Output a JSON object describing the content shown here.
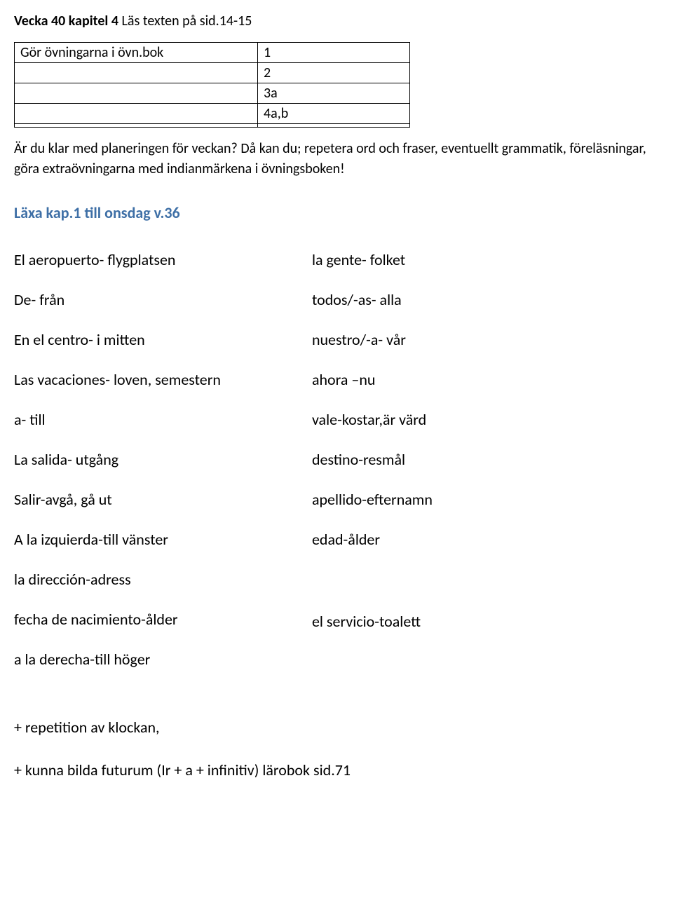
{
  "header": {
    "bold": "Vecka 40 kapitel 4",
    "rest": "  Läs texten på sid.14-15"
  },
  "exerciseTable": {
    "label": "Gör övningarna  i övn.bok",
    "rows": [
      "1",
      "2",
      "3a",
      "4a,b",
      ""
    ]
  },
  "paragraph": "Är du klar med planeringen för veckan?  Då kan du; repetera ord och fraser, eventuellt grammatik, föreläsningar, göra extraövningarna med indianmärkena i övningsboken!",
  "subheading": "Läxa  kap.1 till  onsdag v.36",
  "vocab": {
    "left": [
      "El aeropuerto- flygplatsen",
      "De- från",
      "En el centro- i mitten",
      "Las vacaciones- loven, semestern",
      "a- till",
      "La salida- utgång",
      "Salir-avgå, gå ut",
      "A la izquierda-till vänster",
      "la dirección-adress",
      "fecha de nacimiento-ålder",
      "a la derecha-till höger"
    ],
    "right": [
      "la gente- folket",
      "todos/-as- alla",
      "nuestro/-a- vår",
      "ahora –nu",
      "vale-kostar,är värd",
      "destino-resmål",
      "apellido-efternamn",
      "edad-ålder",
      "",
      "el servicio-toalett",
      ""
    ]
  },
  "footer": {
    "line1": "+ repetition av klockan,",
    "line2": "+ kunna bilda futurum (Ir + a + infinitiv) lärobok sid.71"
  }
}
